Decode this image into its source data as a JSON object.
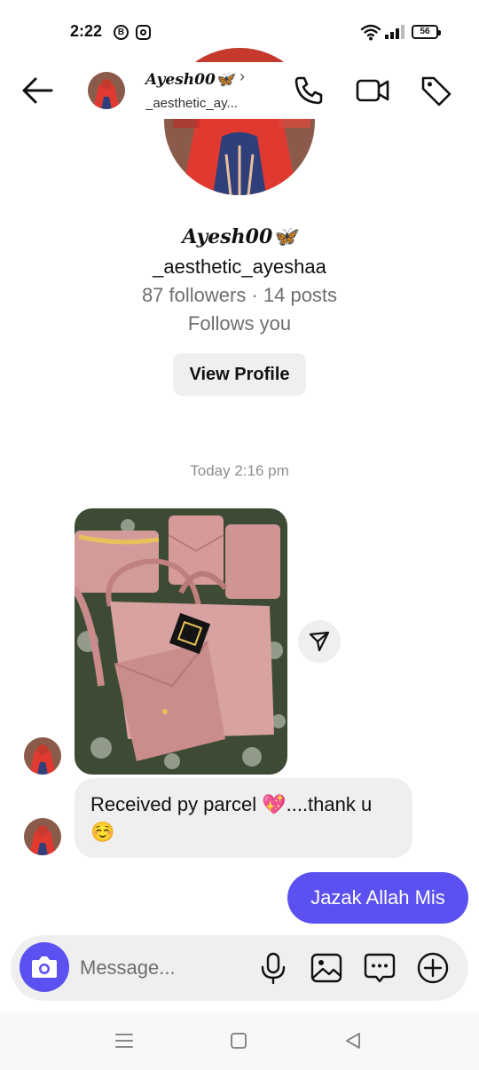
{
  "status_bar": {
    "time": "2:22",
    "b_badge": "B",
    "battery": "56"
  },
  "header": {
    "display_name": "Ayesh00🦋",
    "username": "_aesthetic_ay...",
    "chevron": "›"
  },
  "profile": {
    "display_name": "Ayesh00🦋",
    "username": "_aesthetic_ayeshaa",
    "stats": "87 followers · 14 posts",
    "follows_you": "Follows you",
    "view_profile_label": "View Profile"
  },
  "thread": {
    "timestamp": "Today 2:16 pm",
    "messages": [
      {
        "type": "photo",
        "from": "them",
        "content": "pink handbag set photo"
      },
      {
        "type": "text",
        "from": "them",
        "text": "Received py parcel 💖....thank u ☺️"
      },
      {
        "type": "text",
        "from": "me",
        "text": "Jazak Allah Mis"
      }
    ]
  },
  "composer": {
    "placeholder": "Message..."
  },
  "icons": {
    "back": "back-arrow-icon",
    "call": "phone-icon",
    "video": "video-camera-icon",
    "tag": "tag-icon",
    "share": "send-icon",
    "camera": "camera-icon",
    "mic": "microphone-icon",
    "gallery": "image-icon",
    "sticker": "chat-bubble-icon",
    "add": "plus-circle-icon"
  },
  "colors": {
    "accent": "#5b51f0",
    "bubble_in": "#efefef",
    "secondary_text": "#6e6e6e"
  }
}
